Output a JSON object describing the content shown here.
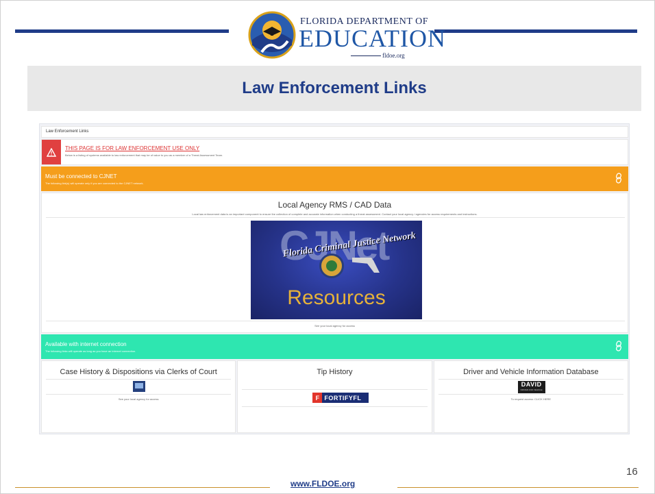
{
  "slide": {
    "logo": {
      "line1": "FLORIDA DEPARTMENT OF",
      "line2": "EDUCATION",
      "url": "fldoe.org"
    },
    "title": "Law Enforcement Links",
    "page_number": "16",
    "footer_url": "www.FLDOE.org",
    "colors": {
      "navy": "#1f3c88",
      "gold_rule": "#c98f2a",
      "title_band": "#e8e8e8"
    }
  },
  "screenshot": {
    "breadcrumb": "Law Enforcement Links",
    "alert": {
      "icon": "warning-icon",
      "title": "THIS PAGE IS FOR LAW ENFORCEMENT USE ONLY",
      "subtitle": "Below is a listing of systems available to law enforcement that may be of value to you as a member of a Threat Assessment Team."
    },
    "cjnet_section": {
      "title": "Must be connected to CJNET",
      "subtitle": "The following link(s) will operate only if you are connected to the CJNET network.",
      "link_icon": "link-icon",
      "color": "#f59e1b"
    },
    "rms_card": {
      "title": "Local Agency RMS / CAD Data",
      "description": "Local law enforcement data is an important component to ensure the collection of complete and accurate information when conducting a threat assessment. Contact your local agency / agencies for access requirements and instructions.",
      "banner": {
        "big_text": "CJNet",
        "arc_text": "Florida Criminal Justice Network",
        "resources_text": "Resources"
      },
      "access_note": "See your local agency for access"
    },
    "internet_section": {
      "title": "Available with internet connection",
      "subtitle": "The following links will operate as long as you have an internet connection.",
      "link_icon": "link-icon",
      "color": "#2ee6b0"
    },
    "columns": [
      {
        "title": "Case History & Dispositions via Clerks of Court",
        "note": "See your local agency for access"
      },
      {
        "title": "Tip History",
        "logo_badge": "F",
        "logo_text": "FORTIFYFL"
      },
      {
        "title": "Driver and Vehicle Information Database",
        "logo_main": "DAVID",
        "logo_sub": "DRIVER AND VEHICLE",
        "note": "To request access: CLICK HERE"
      }
    ]
  }
}
